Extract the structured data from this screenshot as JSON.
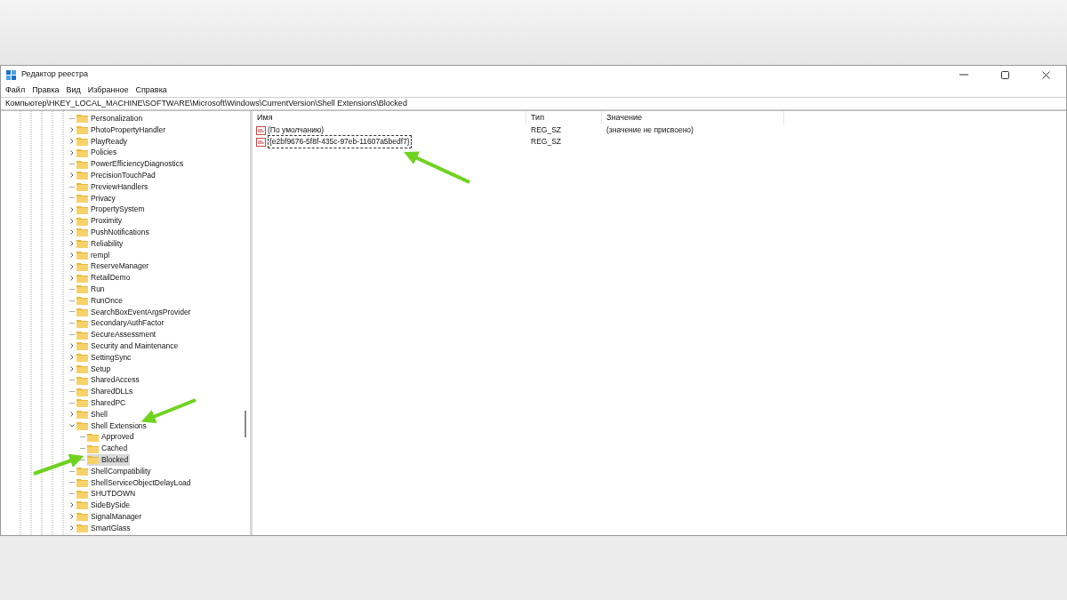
{
  "window": {
    "title": "Редактор реестра"
  },
  "menu": [
    "Файл",
    "Правка",
    "Вид",
    "Избранное",
    "Справка"
  ],
  "address": "Компьютер\\HKEY_LOCAL_MACHINE\\SOFTWARE\\Microsoft\\Windows\\CurrentVersion\\Shell Extensions\\Blocked",
  "tree": [
    {
      "label": "Personalization",
      "expandable": false,
      "selected": false
    },
    {
      "label": "PhotoPropertyHandler",
      "expandable": true,
      "expanded": false,
      "selected": false
    },
    {
      "label": "PlayReady",
      "expandable": true,
      "expanded": false,
      "selected": false
    },
    {
      "label": "Policies",
      "expandable": true,
      "expanded": false,
      "selected": false
    },
    {
      "label": "PowerEfficiencyDiagnostics",
      "expandable": false,
      "selected": false
    },
    {
      "label": "PrecisionTouchPad",
      "expandable": true,
      "expanded": false,
      "selected": false
    },
    {
      "label": "PreviewHandlers",
      "expandable": false,
      "selected": false
    },
    {
      "label": "Privacy",
      "expandable": false,
      "selected": false
    },
    {
      "label": "PropertySystem",
      "expandable": true,
      "expanded": false,
      "selected": false
    },
    {
      "label": "Proximity",
      "expandable": true,
      "expanded": false,
      "selected": false
    },
    {
      "label": "PushNotifications",
      "expandable": true,
      "expanded": false,
      "selected": false
    },
    {
      "label": "Reliability",
      "expandable": true,
      "expanded": false,
      "selected": false
    },
    {
      "label": "rempl",
      "expandable": true,
      "expanded": false,
      "selected": false
    },
    {
      "label": "ReserveManager",
      "expandable": true,
      "expanded": false,
      "selected": false
    },
    {
      "label": "RetailDemo",
      "expandable": true,
      "expanded": false,
      "selected": false
    },
    {
      "label": "Run",
      "expandable": false,
      "selected": false
    },
    {
      "label": "RunOnce",
      "expandable": false,
      "selected": false
    },
    {
      "label": "SearchBoxEventArgsProvider",
      "expandable": false,
      "selected": false
    },
    {
      "label": "SecondaryAuthFactor",
      "expandable": false,
      "selected": false
    },
    {
      "label": "SecureAssessment",
      "expandable": false,
      "selected": false
    },
    {
      "label": "Security and Maintenance",
      "expandable": true,
      "expanded": false,
      "selected": false
    },
    {
      "label": "SettingSync",
      "expandable": true,
      "expanded": false,
      "selected": false
    },
    {
      "label": "Setup",
      "expandable": true,
      "expanded": false,
      "selected": false
    },
    {
      "label": "SharedAccess",
      "expandable": false,
      "selected": false
    },
    {
      "label": "SharedDLLs",
      "expandable": false,
      "selected": false
    },
    {
      "label": "SharedPC",
      "expandable": false,
      "selected": false
    },
    {
      "label": "Shell",
      "expandable": true,
      "expanded": false,
      "selected": false
    },
    {
      "label": "Shell Extensions",
      "expandable": true,
      "expanded": true,
      "selected": false,
      "children": [
        {
          "label": "Approved",
          "expandable": false,
          "selected": false
        },
        {
          "label": "Cached",
          "expandable": false,
          "selected": false
        },
        {
          "label": "Blocked",
          "expandable": false,
          "selected": true
        }
      ]
    },
    {
      "label": "ShellCompatibility",
      "expandable": false,
      "selected": false
    },
    {
      "label": "ShellServiceObjectDelayLoad",
      "expandable": false,
      "selected": false
    },
    {
      "label": "SHUTDOWN",
      "expandable": false,
      "selected": false
    },
    {
      "label": "SideBySide",
      "expandable": true,
      "expanded": false,
      "selected": false
    },
    {
      "label": "SignalManager",
      "expandable": true,
      "expanded": false,
      "selected": false
    },
    {
      "label": "SmartGlass",
      "expandable": true,
      "expanded": false,
      "selected": false
    }
  ],
  "values": {
    "columns": [
      "Имя",
      "Тип",
      "Значение"
    ],
    "rows": [
      {
        "name": "(По умолчанию)",
        "type": "REG_SZ",
        "data": "(значение не присвоено)",
        "editing": false
      },
      {
        "name": "{e2bf9676-5f8f-435c-97eb-11607a5bedf7}",
        "type": "REG_SZ",
        "editing": true
      }
    ]
  }
}
